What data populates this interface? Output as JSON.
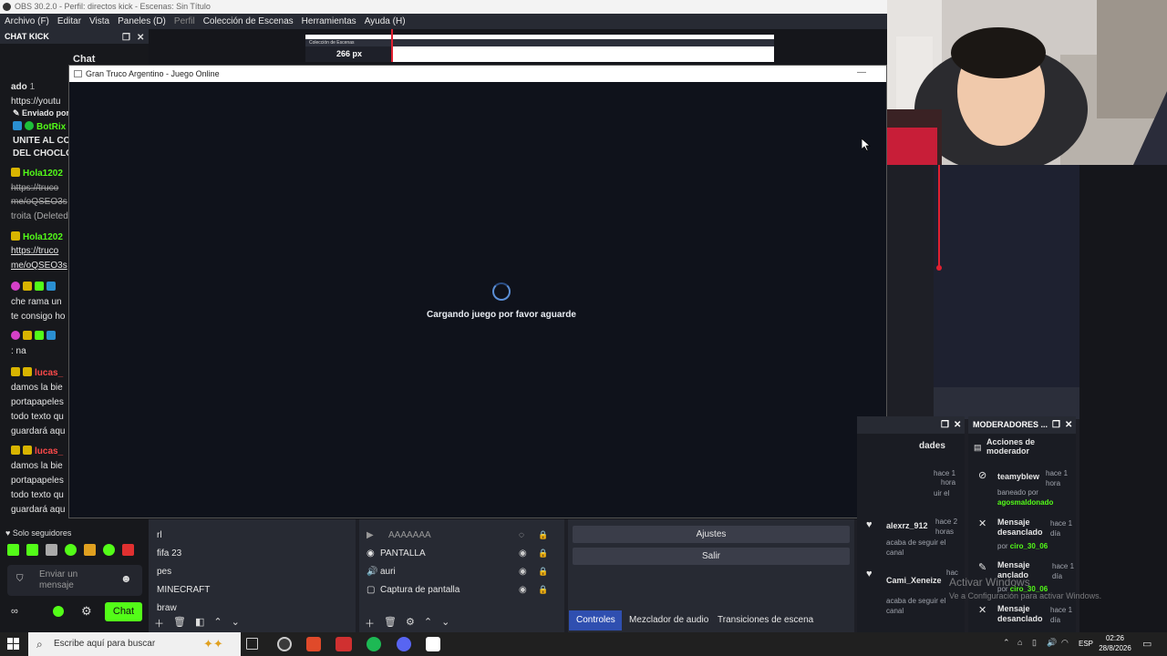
{
  "obs": {
    "title": "OBS 30.2.0 - Perfil: directos kick - Escenas: Sin Título",
    "menu": [
      "Archivo (F)",
      "Editar",
      "Vista",
      "Paneles (D)",
      "Perfil",
      "Colección de Escenas",
      "Herramientas",
      "Ayuda (H)"
    ],
    "nested_size": "266 px"
  },
  "chat_dock": {
    "title": "CHAT KICK",
    "tab": "Chat",
    "lines": [
      {
        "text": "ado",
        "extra": "1"
      },
      {
        "text": "https://youtu"
      },
      {
        "text": "Enviado por"
      },
      {
        "user": "BotRix"
      },
      {
        "text": "UNITE AL CO"
      },
      {
        "text": "DEL CHOCLO"
      },
      {
        "user": "Hola1202"
      },
      {
        "text": "https://truco"
      },
      {
        "text": "me/oQSEO3s"
      },
      {
        "text": "troita (Deleted"
      },
      {
        "user": "Hola1202"
      },
      {
        "text": "https://truco"
      },
      {
        "text": "me/oQSEO3s"
      },
      {
        "text": "che rama un"
      },
      {
        "text": "te consigo ho"
      },
      {
        "text": ": na"
      },
      {
        "user": "lucas_"
      },
      {
        "text": "damos la bie"
      },
      {
        "text": "portapapeles"
      },
      {
        "text": "todo texto qu"
      },
      {
        "text": "guardará aqu"
      },
      {
        "user": "lucas_"
      },
      {
        "text": "damos la bie"
      },
      {
        "text": "portapapeles"
      },
      {
        "text": "todo texto qu"
      },
      {
        "text": "guardará aqu"
      }
    ],
    "followers_only": "Solo seguidores",
    "input_placeholder": "Enviar un mensaje",
    "chat_button": "Chat"
  },
  "game": {
    "window_title": "Gran Truco Argentino - Juego Online",
    "loading": "Cargando juego por favor aguarde"
  },
  "scenes": [
    "rl",
    "fifa 23",
    "pes",
    "MINECRAFT",
    "braw"
  ],
  "sources": [
    "AAAAAAA",
    "PANTALLA",
    "auri",
    "Captura de pantalla"
  ],
  "controls": {
    "settings": "Ajustes",
    "exit": "Salir"
  },
  "tabs": [
    "Controles",
    "Mezclador de audio",
    "Transiciones de escena"
  ],
  "activity": {
    "head": "dades",
    "items": [
      {
        "user": "alexrz_912",
        "time": "hace 2 horas",
        "text": "acaba de seguir el canal"
      },
      {
        "user": "Cami_Xeneize",
        "time": "hac",
        "text": "acaba de seguir el canal"
      }
    ],
    "top": [
      "hace 1",
      "hora",
      "uir el"
    ]
  },
  "moderators": {
    "title": "MODERADORES ...",
    "section": "Acciones de moderador",
    "actions": [
      {
        "title": "teamyblew",
        "time": "hace 1 hora",
        "detail": "baneado por",
        "by": "agosmaldonado"
      },
      {
        "title": "Mensaje desanclado",
        "time": "hace 1 día",
        "detail": "por",
        "by": "ciro_30_06"
      },
      {
        "title": "Mensaje anclado",
        "time": "hace 1 día",
        "detail": "por",
        "by": "ciro_30_06"
      },
      {
        "title": "Mensaje desanclado",
        "time": "hace 1 día"
      }
    ]
  },
  "windows": {
    "activate": "Activar Windows",
    "activate_sub": "Ve a Configuración para activar Windows.",
    "search": "Escribe aquí para buscar",
    "lang": "ESP",
    "time": "02:26",
    "date": "28/8/2026"
  },
  "colors": {
    "accent": "#53fc18",
    "tab_active": "#2f4fb0",
    "red_line": "#e02030"
  }
}
